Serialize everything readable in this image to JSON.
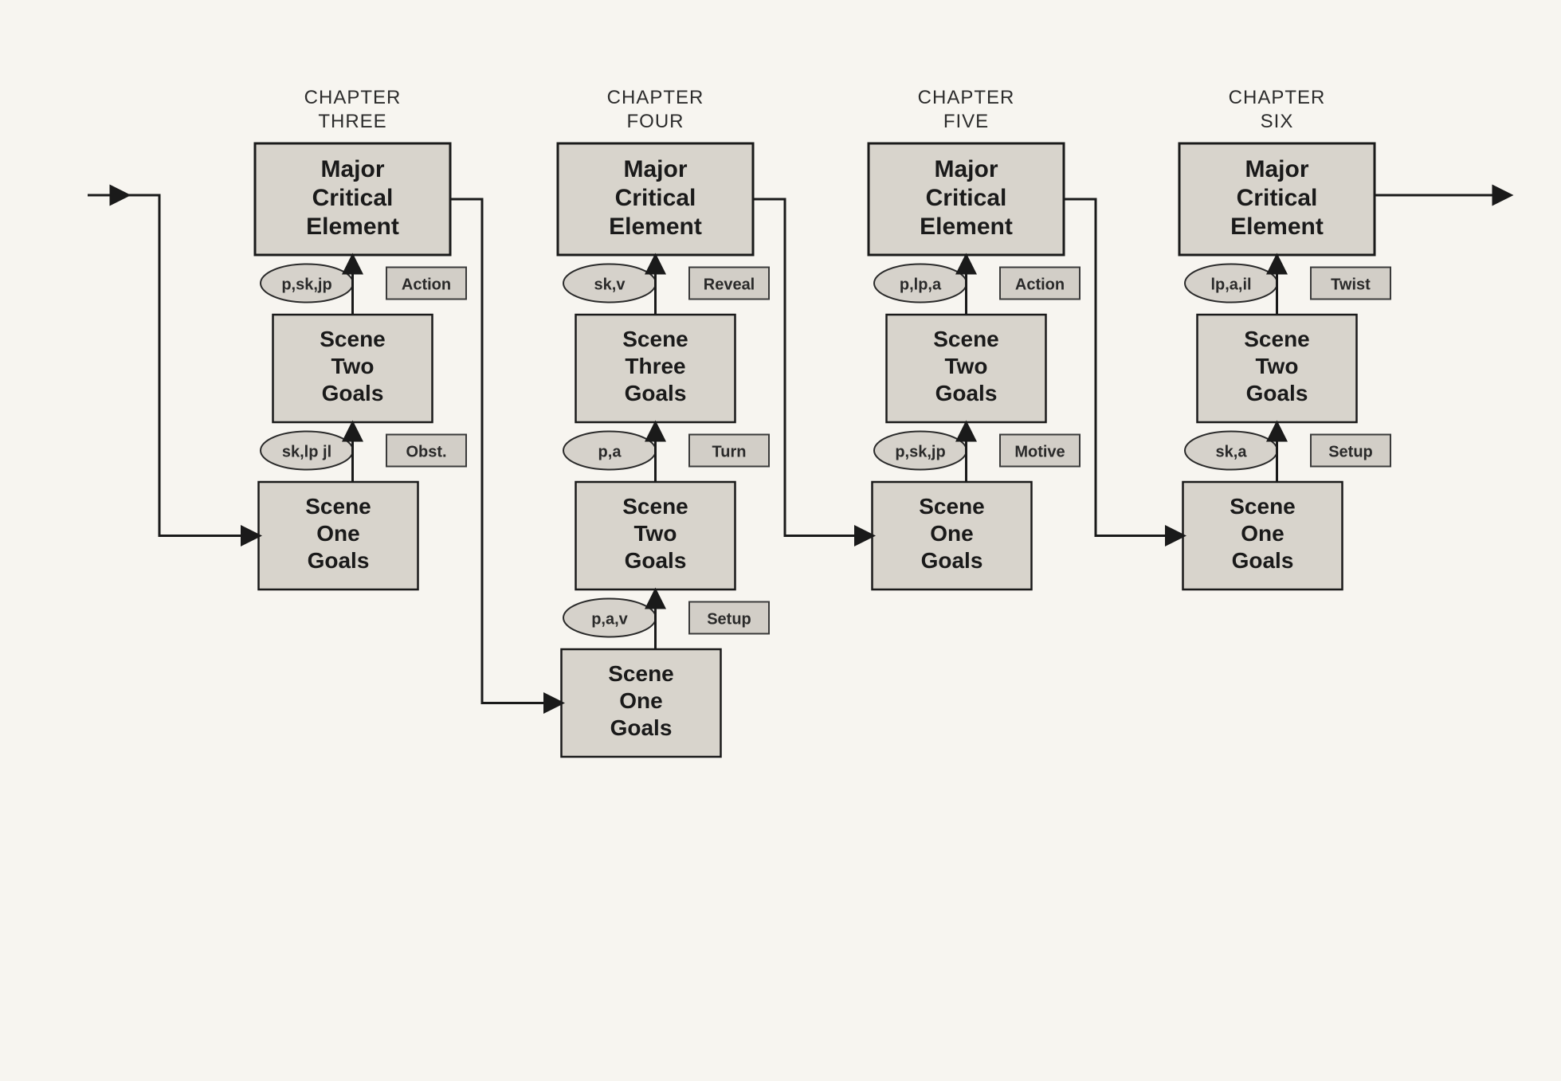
{
  "chapters": [
    {
      "header1": "CHAPTER",
      "header2": "THREE",
      "major": "Major\nCritical\nElement",
      "scenes": [
        {
          "title": "Scene\nOne\nGoals",
          "oval": "sk,lp jl",
          "tag": "Obst."
        },
        {
          "title": "Scene\nTwo\nGoals",
          "oval": "p,sk,jp",
          "tag": "Action"
        }
      ]
    },
    {
      "header1": "CHAPTER",
      "header2": "FOUR",
      "major": "Major\nCritical\nElement",
      "scenes": [
        {
          "title": "Scene\nOne\nGoals",
          "oval": "p,a,v",
          "tag": "Setup"
        },
        {
          "title": "Scene\nTwo\nGoals",
          "oval": "p,a",
          "tag": "Turn"
        },
        {
          "title": "Scene\nThree\nGoals",
          "oval": "sk,v",
          "tag": "Reveal"
        }
      ]
    },
    {
      "header1": "CHAPTER",
      "header2": "FIVE",
      "major": "Major\nCritical\nElement",
      "scenes": [
        {
          "title": "Scene\nOne\nGoals",
          "oval": "p,sk,jp",
          "tag": "Motive"
        },
        {
          "title": "Scene\nTwo\nGoals",
          "oval": "p,lp,a",
          "tag": "Action"
        }
      ]
    },
    {
      "header1": "CHAPTER",
      "header2": "SIX",
      "major": "Major\nCritical\nElement",
      "scenes": [
        {
          "title": "Scene\nOne\nGoals",
          "oval": "sk,a",
          "tag": "Setup"
        },
        {
          "title": "Scene\nTwo\nGoals",
          "oval": "lp,a,il",
          "tag": "Twist"
        }
      ]
    }
  ]
}
